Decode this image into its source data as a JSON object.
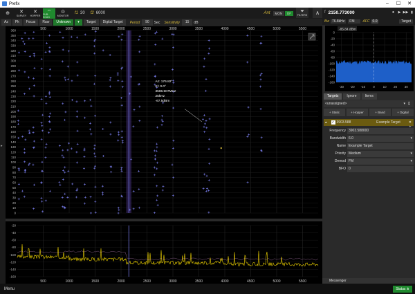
{
  "titlebar": {
    "title": "Prefix",
    "minimize": "–",
    "maximize": "☐",
    "close": "✕"
  },
  "toolbar": {
    "buttons": [
      {
        "id": "ant",
        "label": "",
        "icon": "crosshair-icon",
        "glyph": "⊕",
        "on": false
      },
      {
        "id": "survey",
        "label": "SURVEY",
        "icon": "survey-icon",
        "glyph": "✕",
        "on": false
      },
      {
        "id": "hopper",
        "label": "HOPPER",
        "icon": "hopper-icon",
        "glyph": "✕",
        "on": false
      },
      {
        "id": "subscan",
        "label": "SUB-SCAN",
        "icon": "subscan-icon",
        "glyph": "⇔",
        "on": true
      },
      {
        "id": "monitor",
        "label": "MONITOR",
        "icon": "monitor-icon",
        "glyph": "⊙",
        "on": false
      }
    ],
    "f1_label": "f1",
    "f1_value": "30",
    "f2_label": "f2",
    "f2_value": "6000",
    "ant_label": "Ant",
    "mon_label": "MON",
    "df_label": "DF",
    "filters_label": "FILTERS",
    "up_glyph": "∧"
  },
  "toolbar2": {
    "items": [
      "Az",
      "Pk",
      "Focus",
      "Raw"
    ],
    "unknown": "Unknown",
    "target": "Target",
    "digital_target": "Digital Target",
    "period_label": "Period",
    "period_value": "90",
    "period_unit": "Sec",
    "sensitivity_label": "Sensitivity",
    "sensitivity_value": "15",
    "sensitivity_unit": "dB"
  },
  "main_plot": {
    "x_ticks": [
      "500",
      "1000",
      "1500",
      "2000",
      "2500",
      "3000",
      "3500",
      "4000",
      "4500",
      "5000",
      "5500"
    ],
    "x_values": [
      500,
      1000,
      1500,
      2000,
      2500,
      3000,
      3500,
      4000,
      4500,
      5000,
      5500
    ],
    "xlim": [
      0,
      5800
    ],
    "y_ticks": [
      360,
      350,
      340,
      330,
      320,
      310,
      300,
      290,
      280,
      270,
      260,
      250,
      240,
      230,
      220,
      210,
      200,
      190,
      180,
      170,
      160,
      150,
      140,
      130,
      120,
      110,
      100,
      90,
      80,
      70,
      60,
      50,
      40,
      30,
      20,
      10,
      0
    ],
    "ylim": [
      0,
      360
    ],
    "tooltip": [
      "Az: 176.82°",
      "El: 0.0°",
      "3586.507MHz",
      "25kHz",
      "-67.5dBm"
    ],
    "colors": {
      "marker": "#7b7ff0",
      "cursor": "#7b7ff0",
      "bg": "#000000"
    }
  },
  "spectrum_plot": {
    "y_ticks": [
      "-20",
      "-40",
      "-60",
      "-80",
      "-100",
      "-120",
      "-140",
      "-160"
    ],
    "y_values": [
      -20,
      -40,
      -60,
      -80,
      -100,
      -120,
      -140,
      -160
    ],
    "ylim": [
      -160,
      -20
    ],
    "x_ticks": [
      "500",
      "1000",
      "1500",
      "2000",
      "2500",
      "3000",
      "3500",
      "4000",
      "4500",
      "5000",
      "5500"
    ],
    "colors": {
      "trace": "#f2d600",
      "peak": "#e8a0e8"
    }
  },
  "right_panel": {
    "freq_symbol": "f",
    "frequency": "2150.773000",
    "controls": [
      "⏺",
      "▶",
      "▶▶",
      "▮"
    ],
    "bw_label": "Bw",
    "bw_value": "76.8kHz",
    "demod_value": "FM",
    "afc_label": "AFC",
    "afc_value": "0.0",
    "target_btn": "Target",
    "minispec": {
      "level_label": "-85.84 dBm",
      "y_ticks": [
        "0",
        "-20",
        "-40",
        "-60",
        "-80",
        "-100",
        "-120",
        "-140",
        "-160"
      ],
      "y_values": [
        0,
        -20,
        -40,
        -60,
        -80,
        -100,
        -120,
        -140,
        -160
      ],
      "x_ticks": [
        "-30",
        "-20",
        "-10",
        "0",
        "10",
        "20",
        "30"
      ],
      "x_values": [
        -30,
        -20,
        -10,
        0,
        10,
        20,
        30
      ],
      "noise_floor": -95,
      "color": "#1e5fc8"
    },
    "tabs": [
      "Targets",
      "Ignore",
      "Items"
    ],
    "unassigned": "<unassigned>",
    "add_buttons": [
      "+ Static",
      "+ Hopper",
      "+ Band",
      "+ Digital"
    ],
    "target_header": {
      "freq": "3903.588",
      "name": "Example Target",
      "close": "✕"
    },
    "properties": [
      {
        "label": "Frequency",
        "value": "3903.588000",
        "dropdown": false
      },
      {
        "label": "Bandwidth",
        "value": "6.0",
        "dropdown": true
      },
      {
        "label": "Name",
        "value": "Example Target",
        "dropdown": false
      },
      {
        "label": "Priority",
        "value": "Medium",
        "dropdown": true
      },
      {
        "label": "Demod",
        "value": "FM",
        "dropdown": true
      },
      {
        "label": "BFO",
        "value": "0",
        "dropdown": false
      }
    ],
    "messenger": "Messenger"
  },
  "statusbar": {
    "menu": "Menu",
    "status": "Status"
  }
}
